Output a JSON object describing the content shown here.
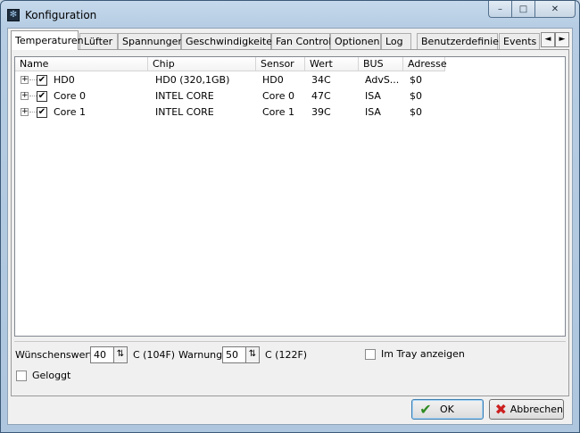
{
  "window": {
    "title": "Konfiguration",
    "minimize": "–",
    "maximize": "□",
    "close": "✕"
  },
  "tabs": [
    {
      "label": "Temperaturen",
      "active": true
    },
    {
      "label": "Lüfter"
    },
    {
      "label": "Spannungen"
    },
    {
      "label": "Geschwindigkeiten"
    },
    {
      "label": "Fan Control"
    },
    {
      "label": "Optionen"
    },
    {
      "label": "Log"
    },
    {
      "label": "Benutzerdefiniert"
    },
    {
      "label": "Events"
    }
  ],
  "tab_scroll": {
    "left": "◄",
    "right": "►"
  },
  "list": {
    "columns": [
      "Name",
      "Chip",
      "Sensor",
      "Wert",
      "BUS",
      "Adresse"
    ],
    "rows": [
      {
        "name": "HD0",
        "chip": "HD0 (320,1GB)",
        "sensor": "HD0",
        "wert": "34C",
        "bus": "AdvS...",
        "adresse": "$0",
        "checked": true
      },
      {
        "name": "Core 0",
        "chip": "INTEL CORE",
        "sensor": "Core 0",
        "wert": "47C",
        "bus": "ISA",
        "adresse": "$0",
        "checked": true
      },
      {
        "name": "Core 1",
        "chip": "INTEL CORE",
        "sensor": "Core 1",
        "wert": "39C",
        "bus": "ISA",
        "adresse": "$0",
        "checked": true
      }
    ],
    "expander": "+",
    "check_mark": "✔"
  },
  "settings": {
    "wunschwert_label": "Wünschenswert",
    "wunschwert_value": "40",
    "wunschwert_unit": "C (104F)",
    "warnung_label": "Warnung",
    "warnung_value": "50",
    "warnung_unit": "C (122F)",
    "tray_label": "Im Tray anzeigen",
    "tray_checked": false,
    "logged_label": "Geloggt",
    "logged_checked": false,
    "spin_glyph": "⇅"
  },
  "buttons": {
    "ok": "OK",
    "cancel": "Abbrechen",
    "ok_icon": "✔",
    "cancel_icon": "✖"
  },
  "colors": {
    "ok_icon": "#2e8b22",
    "cancel_icon": "#cc1f1f"
  }
}
